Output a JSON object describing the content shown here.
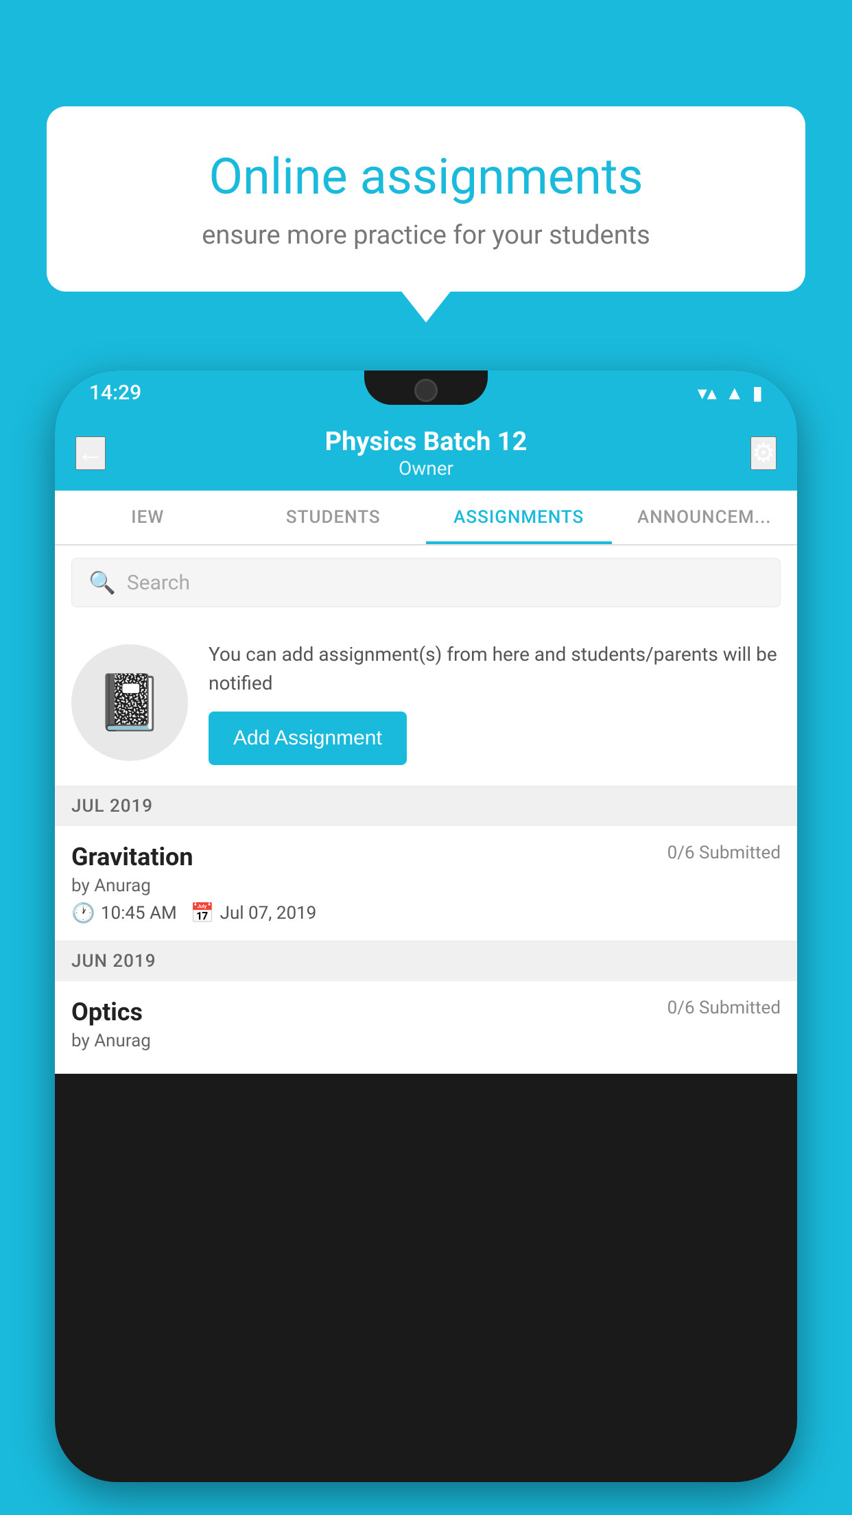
{
  "background": {
    "color": "#1ABADC"
  },
  "speech_bubble": {
    "title": "Online assignments",
    "subtitle": "ensure more practice for your students"
  },
  "phone": {
    "status_bar": {
      "time": "14:29"
    },
    "header": {
      "back_label": "←",
      "title": "Physics Batch 12",
      "subtitle": "Owner",
      "settings_label": "⚙"
    },
    "tabs": [
      {
        "label": "IEW",
        "active": false
      },
      {
        "label": "STUDENTS",
        "active": false
      },
      {
        "label": "ASSIGNMENTS",
        "active": true
      },
      {
        "label": "ANNOUNCEM...",
        "active": false
      }
    ],
    "search": {
      "placeholder": "Search"
    },
    "promo": {
      "text": "You can add assignment(s) from here and students/parents will be notified",
      "button_label": "Add Assignment"
    },
    "sections": [
      {
        "label": "JUL 2019",
        "assignments": [
          {
            "name": "Gravitation",
            "submitted": "0/6 Submitted",
            "author": "by Anurag",
            "time": "10:45 AM",
            "date": "Jul 07, 2019"
          }
        ]
      },
      {
        "label": "JUN 2019",
        "assignments": [
          {
            "name": "Optics",
            "submitted": "0/6 Submitted",
            "author": "by Anurag",
            "time": "",
            "date": ""
          }
        ]
      }
    ]
  }
}
